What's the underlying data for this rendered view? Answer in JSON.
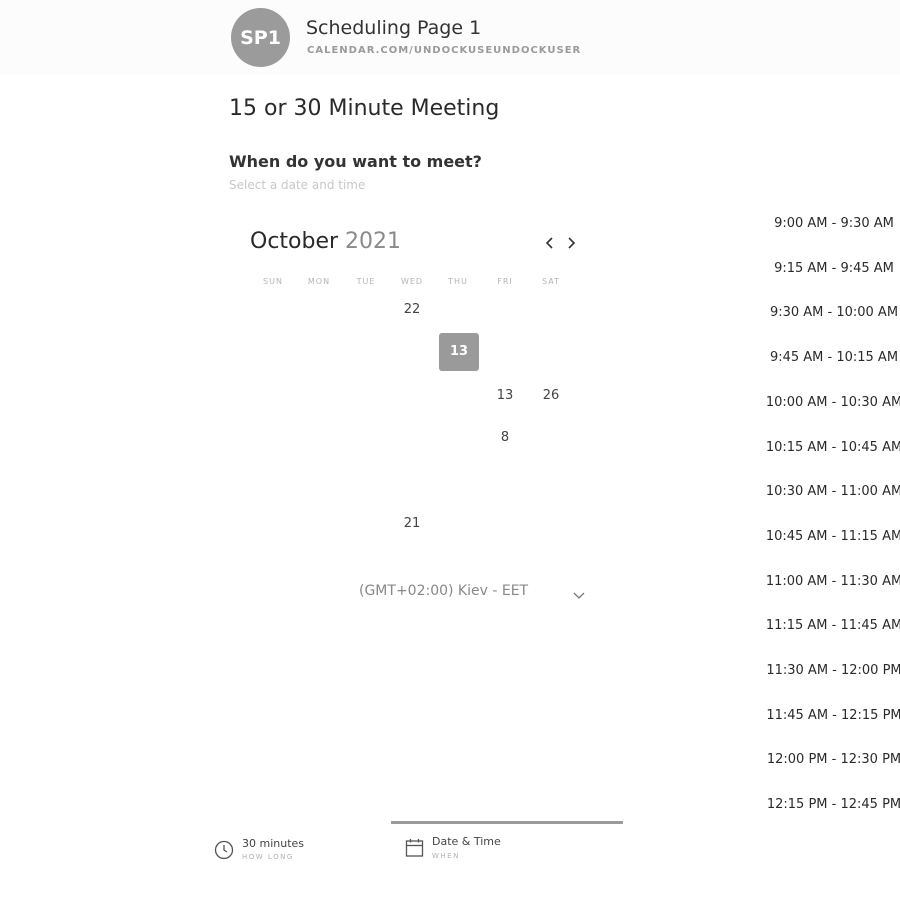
{
  "header": {
    "avatar_initials": "SP1",
    "page_name": "Scheduling Page 1",
    "page_url": "CALENDAR.COM/UNDOCKUSEUNDOCKUSER"
  },
  "event": {
    "title": "15 or 30 Minute Meeting",
    "question": "When do you want to meet?",
    "subtext": "Select a date and time"
  },
  "calendar": {
    "month": "October",
    "year": "2021",
    "prev_icon": "chevron-left-icon",
    "next_icon": "chevron-right-icon",
    "weekdays": [
      "SUN",
      "MON",
      "TUE",
      "WED",
      "THU",
      "FRI",
      "SAT"
    ],
    "days": [
      {
        "label": "22",
        "faded": false,
        "selected": false
      },
      {
        "label": "13",
        "faded": false,
        "selected": true
      },
      {
        "label": "13",
        "faded": false,
        "selected": false
      },
      {
        "label": "26",
        "faded": false,
        "selected": false
      },
      {
        "label": "8",
        "faded": false,
        "selected": false
      },
      {
        "label": "21",
        "faded": false,
        "selected": false
      }
    ]
  },
  "timezone": {
    "label": "(GMT+02:00) Kiev - EET",
    "icon": "chevron-down-icon"
  },
  "time_slots": [
    "9:00 AM - 9:30 AM",
    "9:15 AM - 9:45 AM",
    "9:30 AM - 10:00 AM",
    "9:45 AM - 10:15 AM",
    "10:00 AM - 10:30 AM",
    "10:15 AM - 10:45 AM",
    "10:30 AM - 11:00 AM",
    "10:45 AM - 11:15 AM",
    "11:00 AM - 11:30 AM",
    "11:15 AM - 11:45 AM",
    "11:30 AM - 12:00 PM",
    "11:45 AM - 12:15 PM",
    "12:00 PM - 12:30 PM",
    "12:15 PM - 12:45 PM"
  ],
  "footer": {
    "steps": [
      {
        "label": "30 minutes",
        "sub": "HOW LONG",
        "icon": "clock-icon"
      },
      {
        "label": "Date & Time",
        "sub": "WHEN",
        "icon": "calendar-icon"
      }
    ]
  },
  "colors": {
    "accent": "#9b9b9b",
    "text": "#2a2a2a",
    "muted": "#c8c8c8"
  }
}
